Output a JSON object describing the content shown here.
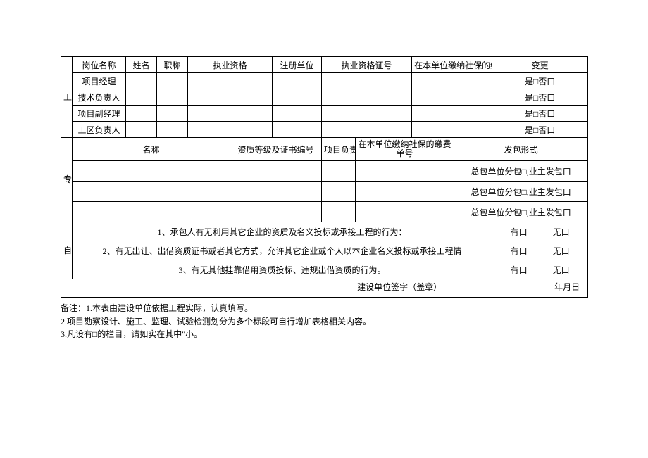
{
  "s1": {
    "vlabel": "工单位",
    "h": {
      "post": "岗位名称",
      "name": "姓名",
      "title": "职称",
      "qual": "执业资格",
      "regunit": "注册单位",
      "certno": "执业资格证号",
      "ssn": "在本单位缴纳社保的缴费单号",
      "change": "变更"
    },
    "rows": [
      {
        "post": "项目经理",
        "change": "是□否口"
      },
      {
        "post": "技术负责人",
        "change": "是□否口"
      },
      {
        "post": "项目副经理",
        "change": "是□否口"
      },
      {
        "post": "工区负责人",
        "change": "是□否口"
      }
    ]
  },
  "s2": {
    "vlabel": "专业分包单位",
    "h": {
      "name": "名称",
      "grade": "资质等级及证书编号",
      "leader": "项目负责人",
      "ssn": "在本单位缴纳社保的缴费单号",
      "mode": "发包形式"
    },
    "opt": "总包单位分包□,业主发包口"
  },
  "s3": {
    "vlabel": "自查情况",
    "q1": "1、承包人有无利用其它企业的资质及名义投标或承接工程的行为：",
    "q2": "2、有无出让、出借资质证书或者其它方式，允许其它企业或个人以本企业名义投标或承接工程情",
    "q3": "3、有无其他挂靠借用资质投标、违规出借资质的行为。",
    "yes": "有口",
    "no": "无口"
  },
  "sig": {
    "label": "建设单位签字（盖章）",
    "date": "年月日"
  },
  "notes": {
    "n1": "备注：1.本表由建设单位依据工程实际，认真填写。",
    "n2": "2.项目勘察设计、施工、监理、试验检测划分为多个标段可自行增加表格相关内容。",
    "n3": "3.凡设有□的栏目，请如实在其中\"小。"
  }
}
